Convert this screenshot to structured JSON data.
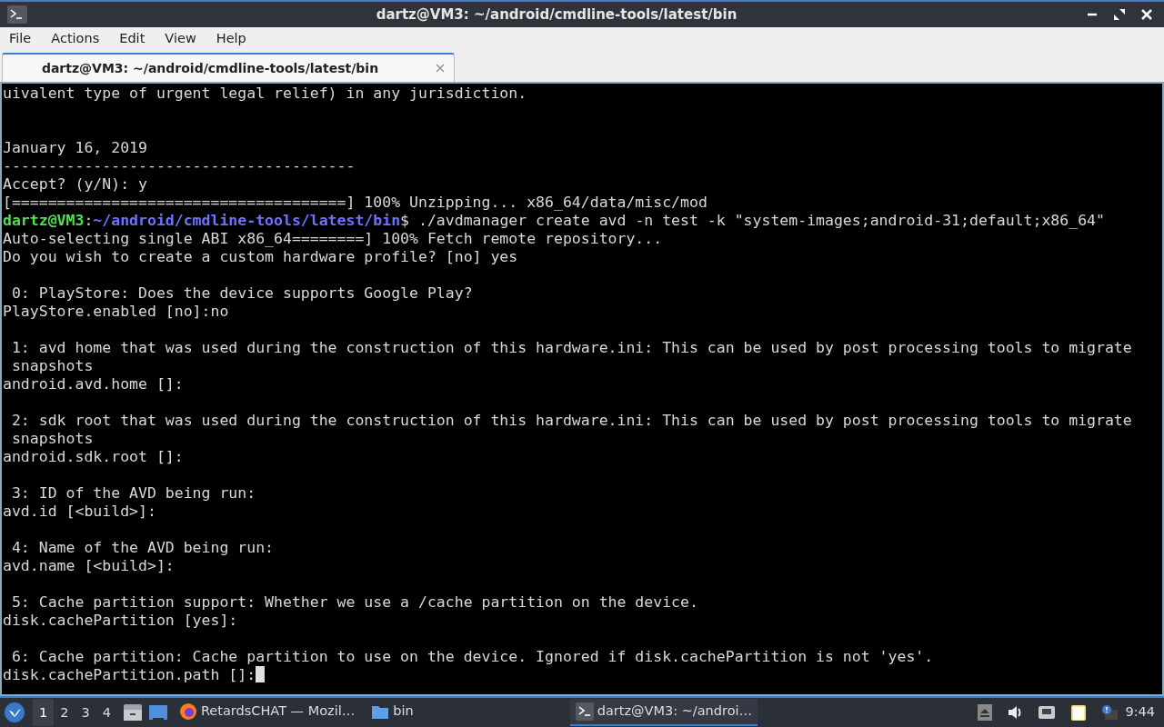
{
  "window": {
    "title": "dartz@VM3: ~/android/cmdline-tools/latest/bin"
  },
  "menu": [
    "File",
    "Actions",
    "Edit",
    "View",
    "Help"
  ],
  "tabs": [
    {
      "label": "dartz@VM3: ~/android/cmdline-tools/latest/bin",
      "selected": true
    }
  ],
  "terminal": {
    "lines": [
      {
        "kind": "text",
        "text": "uivalent type of urgent legal relief) in any jurisdiction."
      },
      {
        "kind": "blank"
      },
      {
        "kind": "blank"
      },
      {
        "kind": "text",
        "text": "January 16, 2019"
      },
      {
        "kind": "text",
        "text": "---------------------------------------"
      },
      {
        "kind": "text",
        "text": "Accept? (y/N): y"
      },
      {
        "kind": "text",
        "text": "[=====================================] 100% Unzipping... x86_64/data/misc/mod"
      },
      {
        "kind": "prompt",
        "user": "dartz@VM3",
        "sep": ":",
        "path": "~/android/cmdline-tools/latest/bin",
        "command": "$ ./avdmanager create avd -n test -k \"system-images;android-31;default;x86_64\""
      },
      {
        "kind": "text",
        "text": "Auto-selecting single ABI x86_64========] 100% Fetch remote repository..."
      },
      {
        "kind": "text",
        "text": "Do you wish to create a custom hardware profile? [no] yes"
      },
      {
        "kind": "blank"
      },
      {
        "kind": "text",
        "text": " 0: PlayStore: Does the device supports Google Play?"
      },
      {
        "kind": "text",
        "text": "PlayStore.enabled [no]:no"
      },
      {
        "kind": "blank"
      },
      {
        "kind": "text",
        "text": " 1: avd home that was used during the construction of this hardware.ini: This can be used by post processing tools to migrate"
      },
      {
        "kind": "text",
        "text": " snapshots"
      },
      {
        "kind": "text",
        "text": "android.avd.home []:"
      },
      {
        "kind": "blank"
      },
      {
        "kind": "text",
        "text": " 2: sdk root that was used during the construction of this hardware.ini: This can be used by post processing tools to migrate"
      },
      {
        "kind": "text",
        "text": " snapshots"
      },
      {
        "kind": "text",
        "text": "android.sdk.root []:"
      },
      {
        "kind": "blank"
      },
      {
        "kind": "text",
        "text": " 3: ID of the AVD being run:"
      },
      {
        "kind": "text",
        "text": "avd.id [<build>]:"
      },
      {
        "kind": "blank"
      },
      {
        "kind": "text",
        "text": " 4: Name of the AVD being run:"
      },
      {
        "kind": "text",
        "text": "avd.name [<build>]:"
      },
      {
        "kind": "blank"
      },
      {
        "kind": "text",
        "text": " 5: Cache partition support: Whether we use a /cache partition on the device."
      },
      {
        "kind": "text",
        "text": "disk.cachePartition [yes]:"
      },
      {
        "kind": "blank"
      },
      {
        "kind": "text",
        "text": " 6: Cache partition: Cache partition to use on the device. Ignored if disk.cachePartition is not 'yes'."
      },
      {
        "kind": "input",
        "text": "disk.cachePartition.path []:"
      }
    ]
  },
  "taskbar": {
    "workspaces": [
      {
        "label": "1",
        "selected": true
      },
      {
        "label": "2",
        "selected": false
      },
      {
        "label": "3",
        "selected": false
      },
      {
        "label": "4",
        "selected": false
      }
    ],
    "tasks": [
      {
        "kind": "browser",
        "label": "RetardsCHAT — Mozil…",
        "selected": false
      },
      {
        "kind": "folder",
        "label": "bin",
        "selected": false
      },
      {
        "kind": "terminal",
        "label": "dartz@VM3: ~/androi…",
        "selected": true
      }
    ],
    "clock": "9:44"
  }
}
